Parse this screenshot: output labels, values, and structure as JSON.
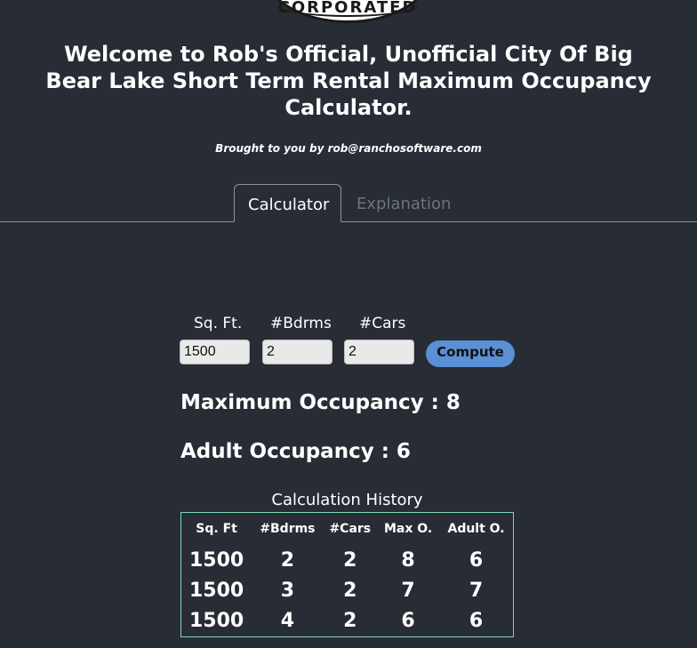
{
  "logo": {
    "seal_text": "CORPORATED"
  },
  "header": {
    "title": "Welcome to Rob's Official, Unofficial City Of Big Bear Lake Short Term Rental Maximum Occupancy Calculator.",
    "byline": "Brought to you by rob@ranchosoftware.com"
  },
  "tabs": [
    {
      "label": "Calculator",
      "active": true
    },
    {
      "label": "Explanation",
      "active": false
    }
  ],
  "form": {
    "sqft_label": "Sq. Ft.",
    "bedrooms_label": "#Bdrms",
    "cars_label": "#Cars",
    "sqft_value": "1500",
    "bedrooms_value": "2",
    "cars_value": "2",
    "compute_label": "Compute"
  },
  "results": {
    "max_occupancy": "Maximum Occupancy : 8",
    "adult_occupancy": "Adult Occupancy : 6"
  },
  "history": {
    "title": "Calculation History",
    "columns": [
      "Sq. Ft",
      "#Bdrms",
      "#Cars",
      "Max O.",
      "Adult O."
    ],
    "rows": [
      [
        "1500",
        "2",
        "2",
        "8",
        "6"
      ],
      [
        "1500",
        "3",
        "2",
        "7",
        "7"
      ],
      [
        "1500",
        "4",
        "2",
        "6",
        "6"
      ]
    ]
  },
  "colors": {
    "background": "#282c34",
    "button": "#5b8fd6",
    "table_border": "#7ed6b0",
    "inactive_tab": "#6c747f"
  }
}
